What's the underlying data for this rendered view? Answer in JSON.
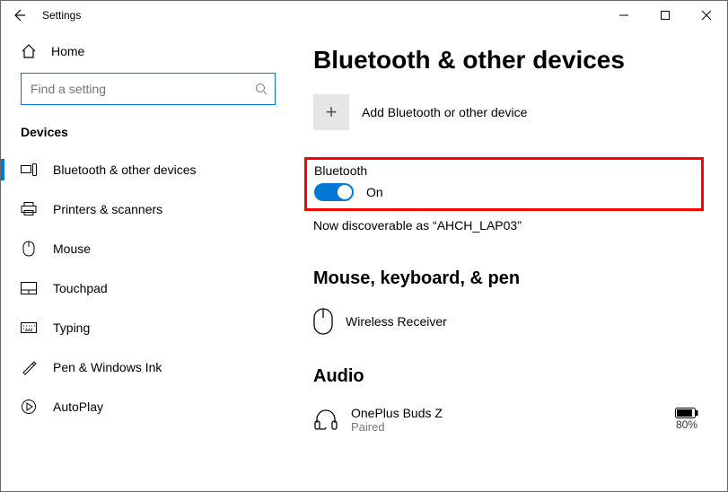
{
  "titlebar": {
    "title": "Settings"
  },
  "sidebar": {
    "home": "Home",
    "search_placeholder": "Find a setting",
    "category": "Devices",
    "items": [
      {
        "label": "Bluetooth & other devices"
      },
      {
        "label": "Printers & scanners"
      },
      {
        "label": "Mouse"
      },
      {
        "label": "Touchpad"
      },
      {
        "label": "Typing"
      },
      {
        "label": "Pen & Windows Ink"
      },
      {
        "label": "AutoPlay"
      }
    ]
  },
  "main": {
    "heading": "Bluetooth & other devices",
    "add_label": "Add Bluetooth or other device",
    "bt_label": "Bluetooth",
    "bt_state": "On",
    "discoverable": "Now discoverable as “AHCH_LAP03”",
    "section_mkp": "Mouse, keyboard, & pen",
    "device_mkp": {
      "name": "Wireless Receiver"
    },
    "section_audio": "Audio",
    "device_audio": {
      "name": "OnePlus Buds Z",
      "status": "Paired",
      "battery": "80%"
    }
  }
}
